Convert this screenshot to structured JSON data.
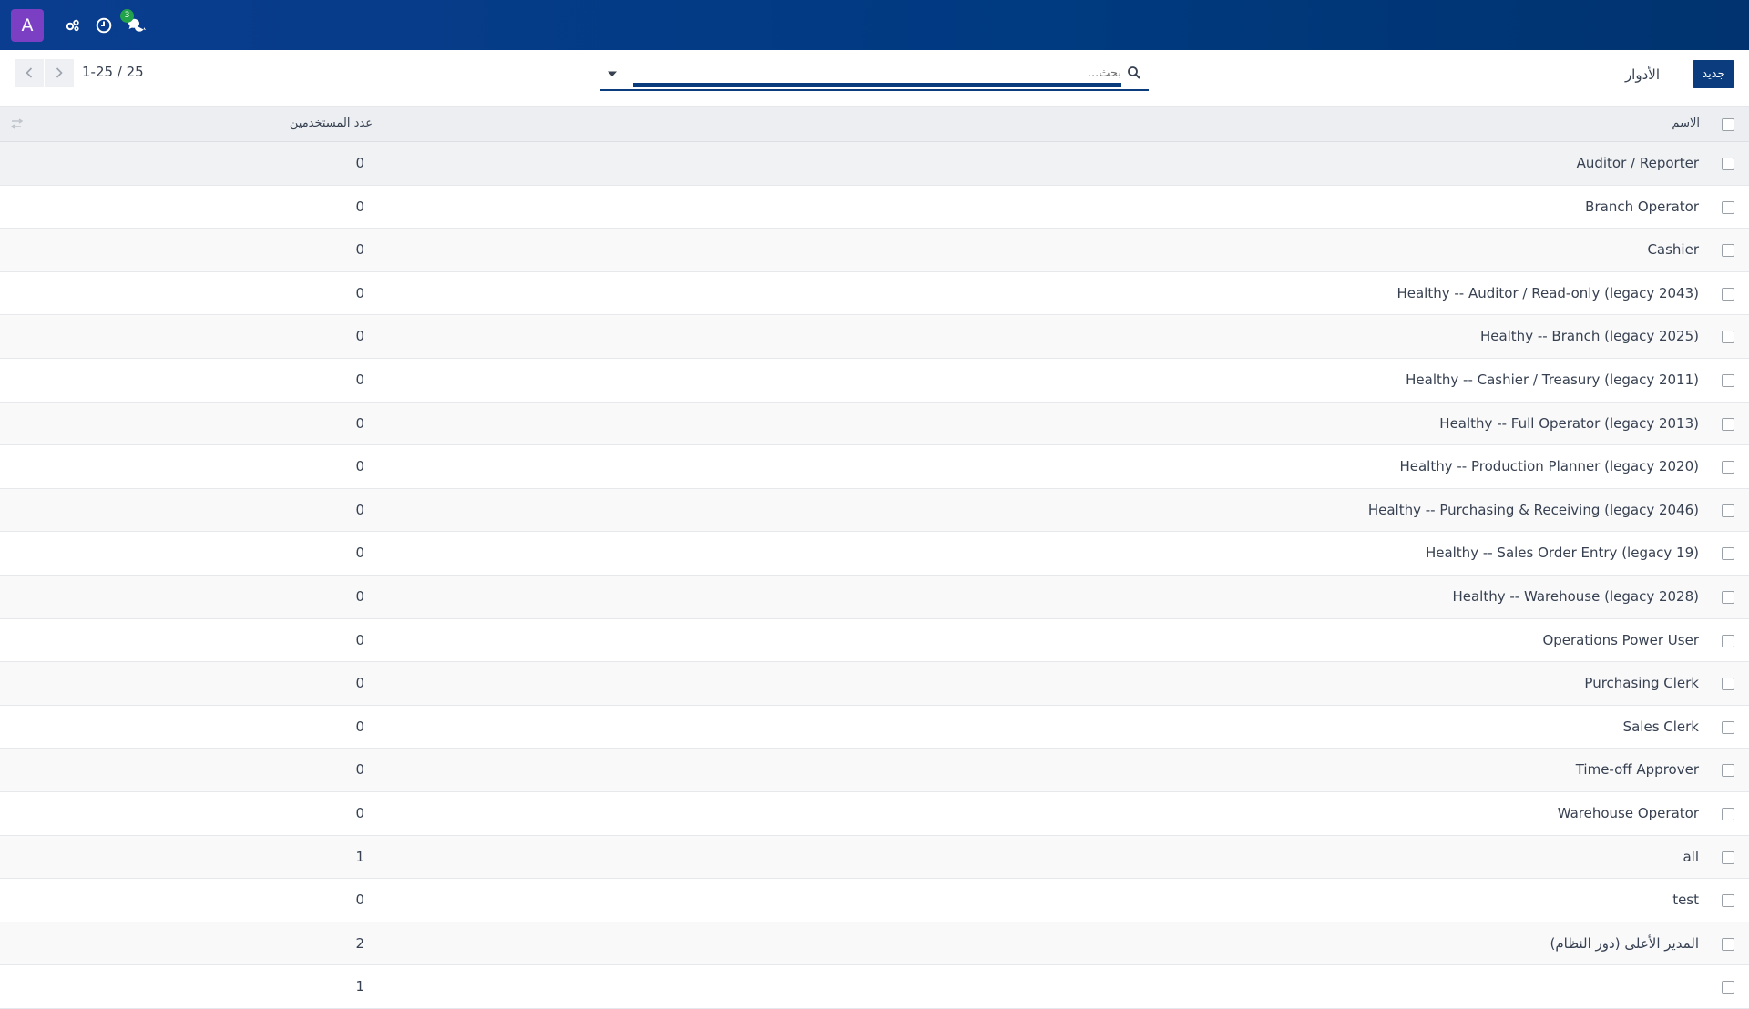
{
  "topbar": {
    "avatar_letter": "A",
    "icons": [
      "settings-gears-icon",
      "clock-icon",
      "chat-icon"
    ],
    "chat_badge": "3"
  },
  "control": {
    "pager": "1-25 / 25",
    "search_placeholder": "بحث...",
    "breadcrumb": "الأدوار",
    "new_button": "جديد"
  },
  "table": {
    "headers": {
      "name": "الاسم",
      "count": "عدد المستخدمين"
    },
    "rows": [
      {
        "name": "Auditor / Reporter",
        "count": "0"
      },
      {
        "name": "Branch Operator",
        "count": "0"
      },
      {
        "name": "Cashier",
        "count": "0"
      },
      {
        "name": "Healthy -- Auditor / Read-only (legacy 2043)",
        "count": "0"
      },
      {
        "name": "Healthy -- Branch (legacy 2025)",
        "count": "0"
      },
      {
        "name": "Healthy -- Cashier / Treasury (legacy 2011)",
        "count": "0"
      },
      {
        "name": "Healthy -- Full Operator (legacy 2013)",
        "count": "0"
      },
      {
        "name": "Healthy -- Production Planner (legacy 2020)",
        "count": "0"
      },
      {
        "name": "Healthy -- Purchasing & Receiving (legacy 2046)",
        "count": "0"
      },
      {
        "name": "Healthy -- Sales Order Entry (legacy 19)",
        "count": "0"
      },
      {
        "name": "Healthy -- Warehouse (legacy 2028)",
        "count": "0"
      },
      {
        "name": "Operations Power User",
        "count": "0"
      },
      {
        "name": "Purchasing Clerk",
        "count": "0"
      },
      {
        "name": "Sales Clerk",
        "count": "0"
      },
      {
        "name": "Time-off Approver",
        "count": "0"
      },
      {
        "name": "Warehouse Operator",
        "count": "0"
      },
      {
        "name": "all",
        "count": "1"
      },
      {
        "name": "test",
        "count": "0"
      },
      {
        "name": "المدير الأعلى (دور النظام)",
        "count": "2"
      },
      {
        "name": "",
        "count": "1"
      }
    ]
  },
  "colors": {
    "topbar": "#003a80",
    "accent": "#0b3d7e",
    "avatar": "#7b3fc4",
    "badge": "#22a34a"
  }
}
